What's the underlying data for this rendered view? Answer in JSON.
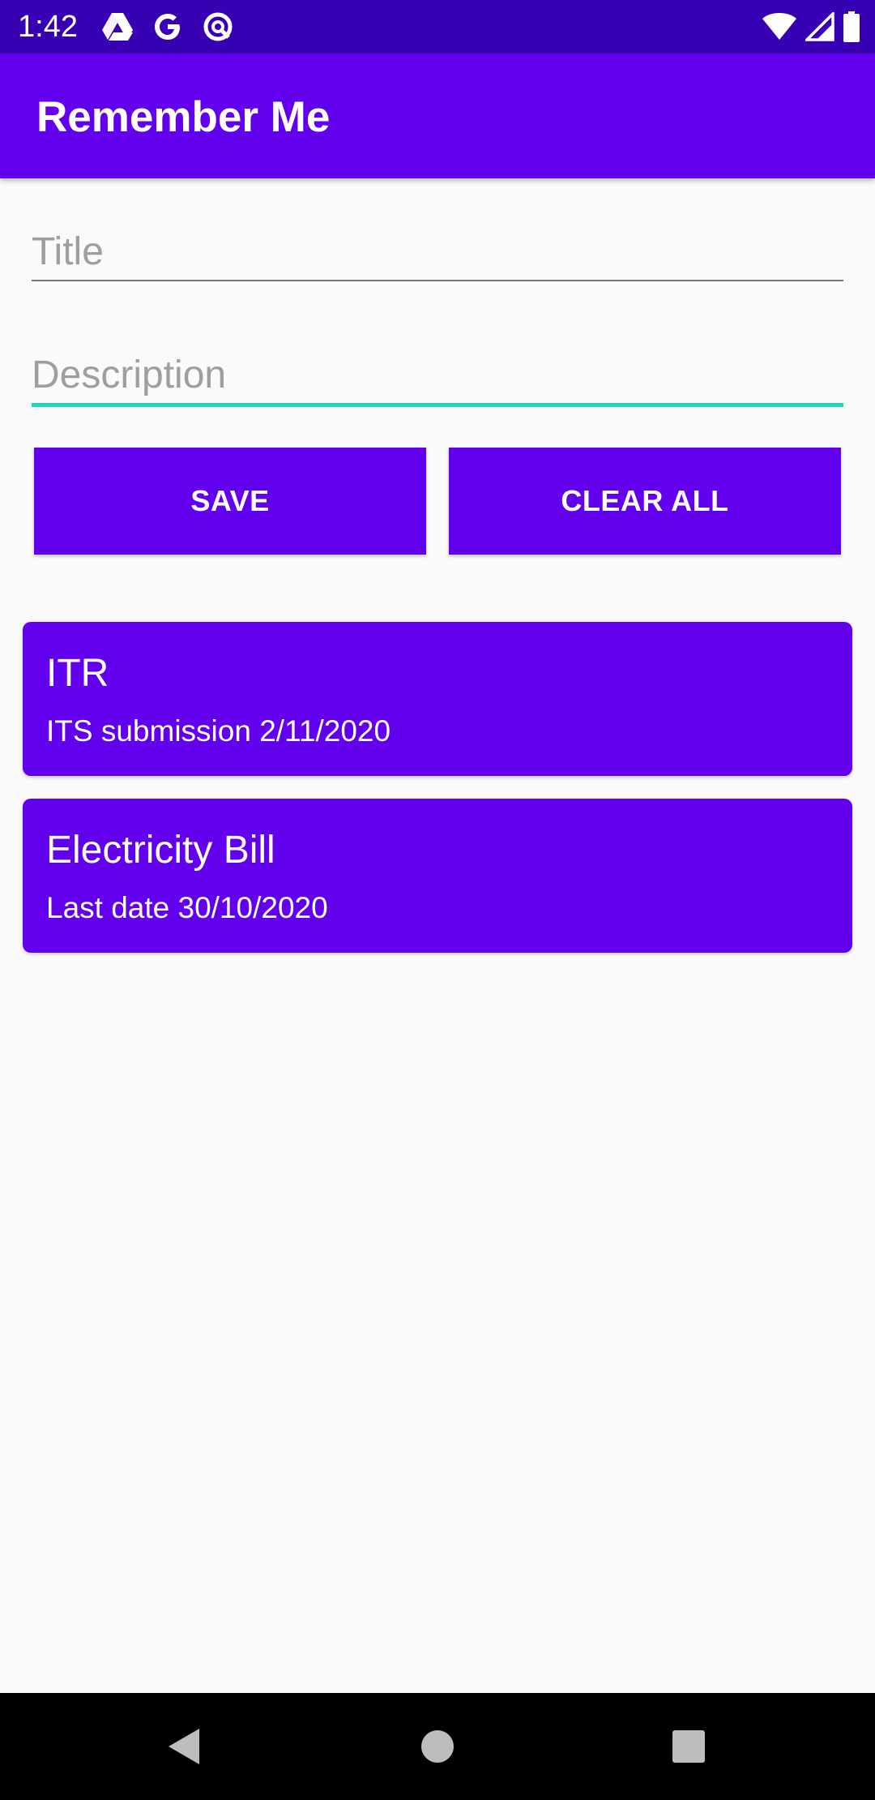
{
  "status_bar": {
    "time": "1:42",
    "left_icons": [
      "drive-icon",
      "google-icon",
      "sync-icon"
    ],
    "right_icons": [
      "wifi-icon",
      "signal-icon",
      "battery-icon"
    ],
    "color": "#3700b3"
  },
  "app_bar": {
    "title": "Remember Me",
    "color": "#6200ee"
  },
  "form": {
    "title_placeholder": "Title",
    "title_value": "",
    "description_placeholder": "Description",
    "description_value": "",
    "focus_color": "#1ed6c4"
  },
  "buttons": {
    "save_label": "SAVE",
    "clear_all_label": "CLEAR ALL"
  },
  "notes": [
    {
      "title": "ITR",
      "description": "ITS submission 2/11/2020"
    },
    {
      "title": "Electricity Bill",
      "description": "Last date 30/10/2020"
    }
  ],
  "nav_bar": {
    "buttons": [
      "back-icon",
      "home-icon",
      "recents-icon"
    ]
  }
}
